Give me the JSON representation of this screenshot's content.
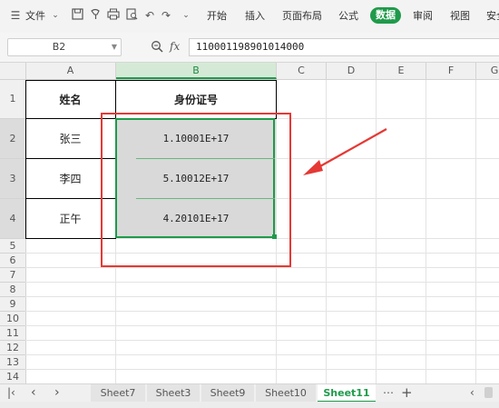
{
  "toolbar": {
    "file_label": "文件",
    "tabs": [
      "开始",
      "插入",
      "页面布局",
      "公式",
      "数据",
      "审阅",
      "视图",
      "安全"
    ],
    "active_tab": "数据"
  },
  "formula_bar": {
    "name_box": "B2",
    "fx_label": "fx",
    "content": "110001198901014000"
  },
  "columns": [
    "A",
    "B",
    "C",
    "D",
    "E",
    "F",
    "G"
  ],
  "rows": [
    "1",
    "2",
    "3",
    "4",
    "5",
    "6",
    "7",
    "8",
    "9",
    "10",
    "11",
    "12",
    "13",
    "14"
  ],
  "table": {
    "headers": [
      "姓名",
      "身份证号"
    ],
    "rows": [
      [
        "张三",
        "1.10001E+17"
      ],
      [
        "李四",
        "5.10012E+17"
      ],
      [
        "正午",
        "4.20101E+17"
      ]
    ]
  },
  "sheets": [
    "Sheet7",
    "Sheet3",
    "Sheet9",
    "Sheet10",
    "Sheet11"
  ],
  "active_sheet": "Sheet11",
  "colors": {
    "accent": "#1f9a4a",
    "annotation": "#e53935"
  }
}
